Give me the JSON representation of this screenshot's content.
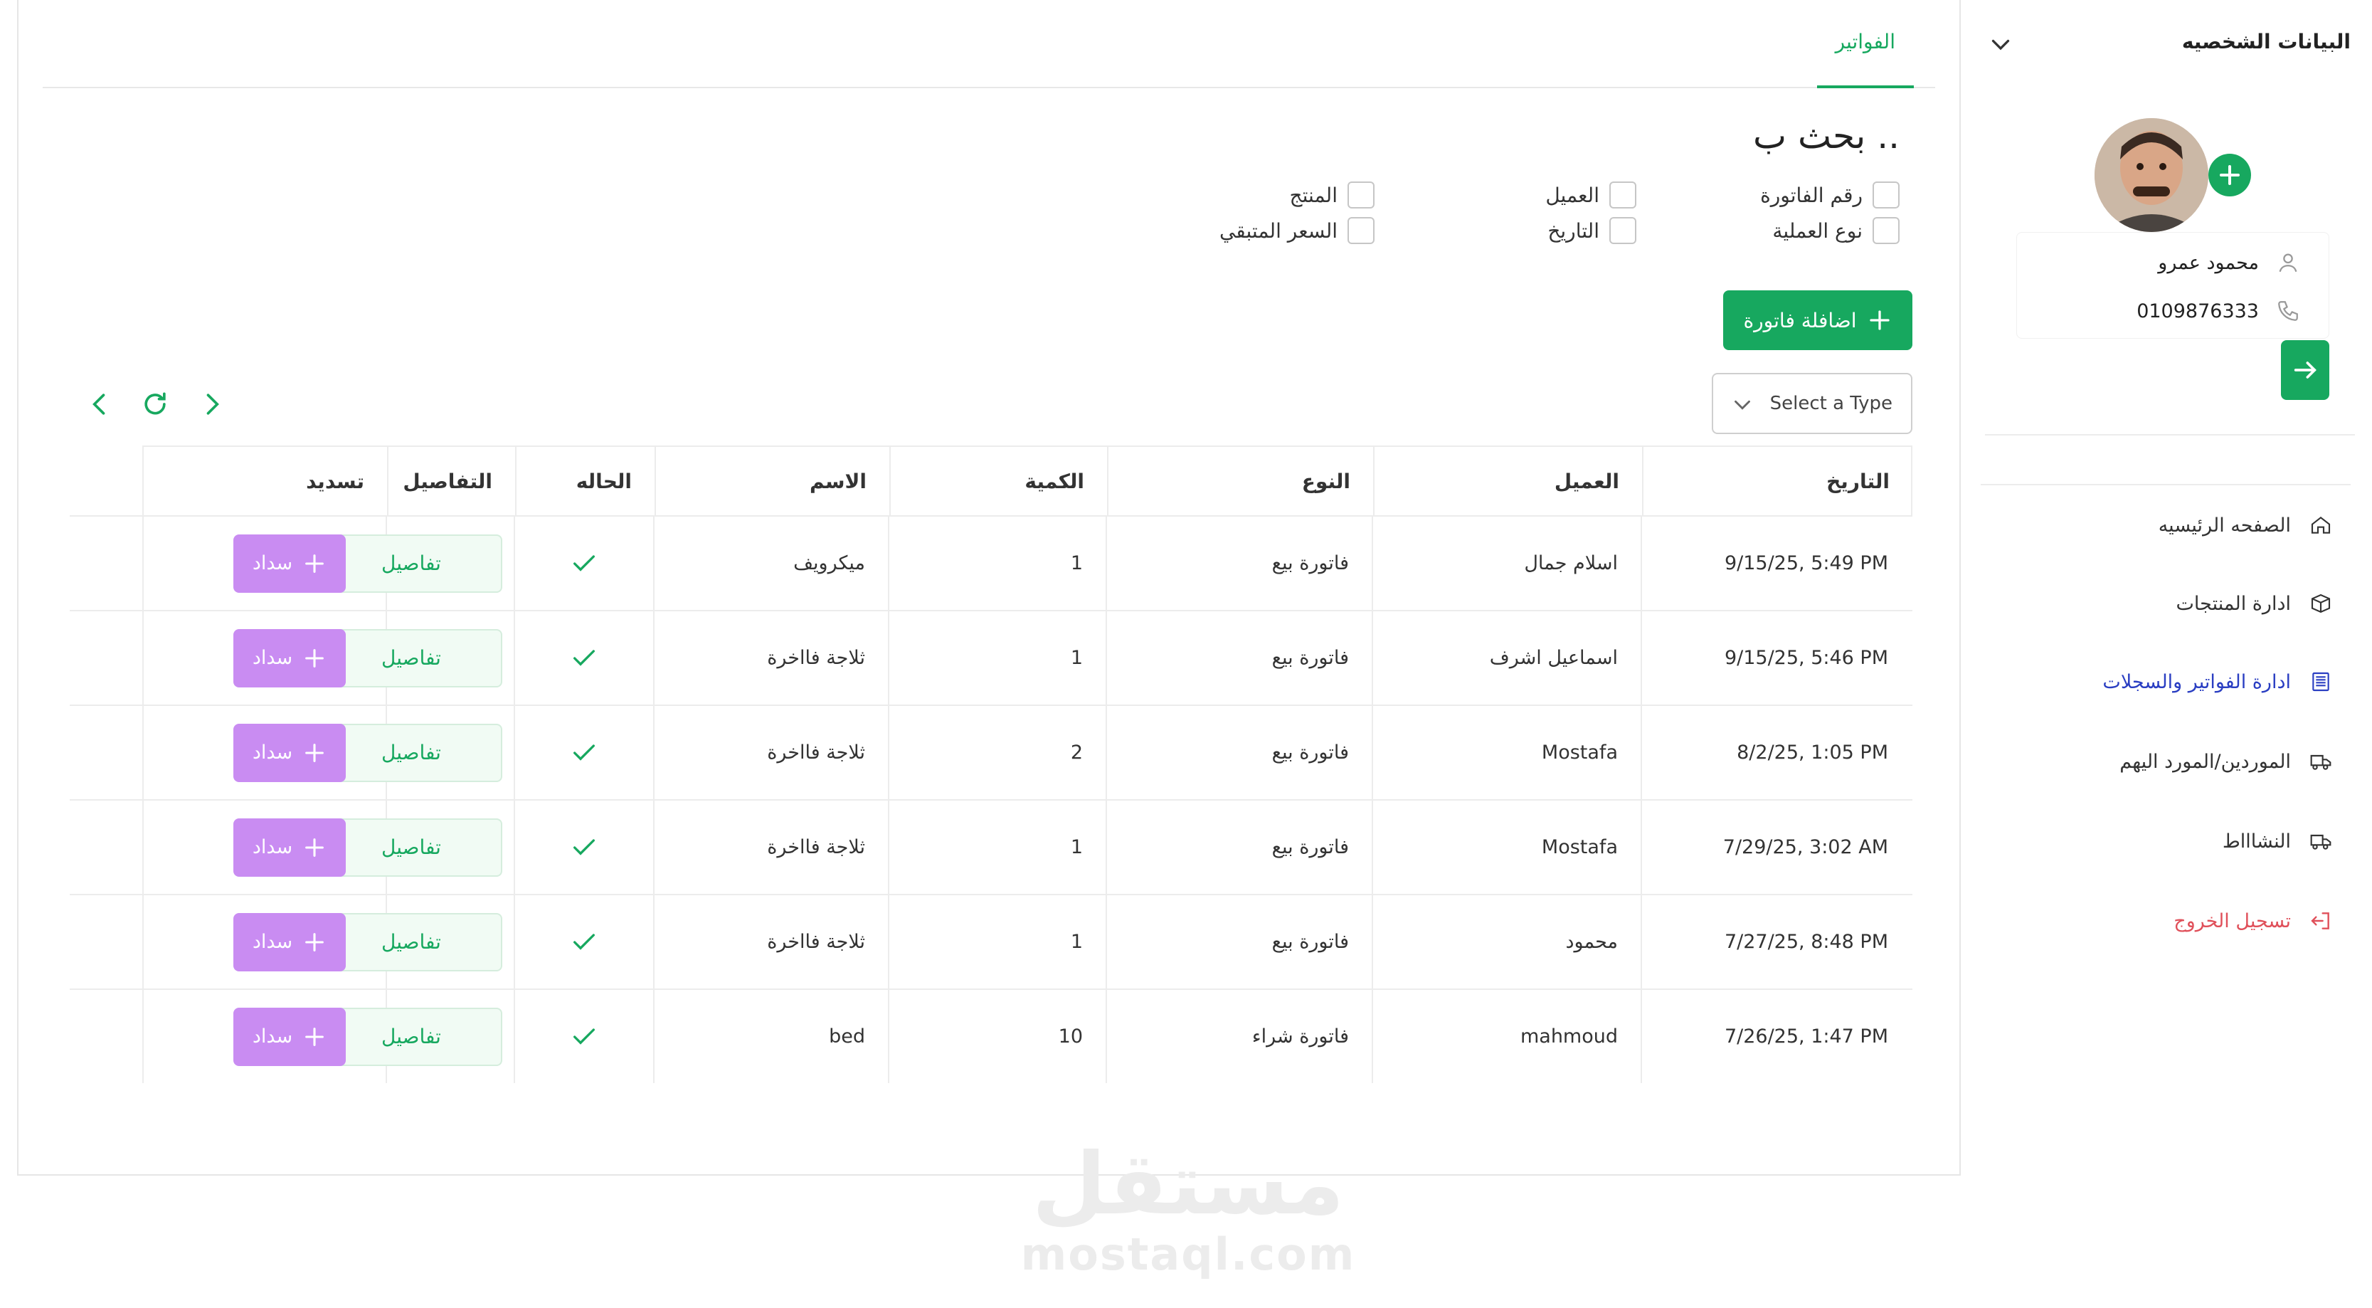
{
  "sidebar": {
    "title": "البيانات الشخصيه",
    "user": {
      "name": "محمود عمرو",
      "phone": "0109876333"
    },
    "nav": [
      {
        "label": "الصفحه الرئيسيه",
        "icon": "home-icon"
      },
      {
        "label": "ادارة المنتجات",
        "icon": "box-icon"
      },
      {
        "label": "ادارة الفواتير والسجلات",
        "icon": "document-icon",
        "active": true
      },
      {
        "label": "الموردين/المورد اليهم",
        "icon": "truck-icon"
      },
      {
        "label": "النشاااط",
        "icon": "truck-icon"
      },
      {
        "label": "تسجيل الخروج",
        "icon": "logout-icon",
        "logout": true
      }
    ]
  },
  "main": {
    "tab": "الفواتير",
    "search_title": "بحث ب ..",
    "filters": [
      [
        "رقم الفاتورة",
        "العميل",
        "المنتج"
      ],
      [
        "نوع العملية",
        "التاريخ",
        "السعر المتبقي"
      ]
    ],
    "add_button": "اضافلة فاتورة",
    "select_placeholder": "Select a Type"
  },
  "table": {
    "headers": [
      "التاريخ",
      "العميل",
      "النوع",
      "الكمية",
      "الاسم",
      "الحاله",
      "التفاصيل",
      "تسديد"
    ],
    "details_label": "تفاصيل",
    "pay_label": "سداد",
    "rows": [
      {
        "date": "9/15/25, 5:49 PM",
        "client": "اسلام جمال",
        "type": "فاتورة بيع",
        "qty": "1",
        "name": "ميكرويف"
      },
      {
        "date": "9/15/25, 5:46 PM",
        "client": "اسماعيل اشرف",
        "type": "فاتورة بيع",
        "qty": "1",
        "name": "ثلاجة فااخرة"
      },
      {
        "date": "8/2/25, 1:05 PM",
        "client": "Mostafa",
        "type": "فاتورة بيع",
        "qty": "2",
        "name": "ثلاجة فااخرة"
      },
      {
        "date": "7/29/25, 3:02 AM",
        "client": "Mostafa",
        "type": "فاتورة بيع",
        "qty": "1",
        "name": "ثلاجة فااخرة"
      },
      {
        "date": "7/27/25, 8:48 PM",
        "client": "محمود",
        "type": "فاتورة بيع",
        "qty": "1",
        "name": "ثلاجة فااخرة"
      },
      {
        "date": "7/26/25, 1:47 PM",
        "client": "mahmoud",
        "type": "فاتورة شراء",
        "qty": "10",
        "name": "bed"
      }
    ]
  },
  "watermark": {
    "arabic": "مستقل",
    "latin": "mostaql.com"
  },
  "colors": {
    "primary": "#17a85f",
    "pay": "#c98cf2",
    "active_nav": "#2a3ec2",
    "logout": "#e0505a"
  }
}
